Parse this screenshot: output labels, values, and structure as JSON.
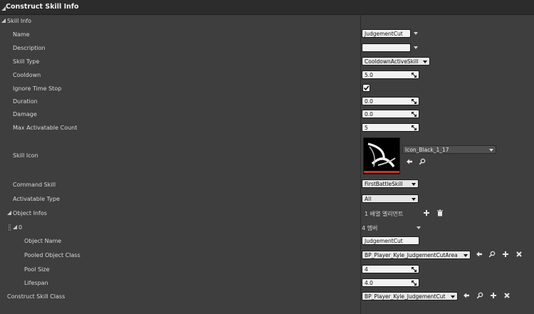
{
  "panel": {
    "title": "Construct Skill Info"
  },
  "sections": {
    "skill_info": "Skill Info",
    "object_infos": "Object Infos",
    "element_index": "0",
    "construct_skill_class": "Construct Skill Class"
  },
  "labels": {
    "name": "Name",
    "description": "Description",
    "skill_type": "Skill Type",
    "cooldown": "Cooldown",
    "ignore_time_stop": "Ignore Time Stop",
    "duration": "Duration",
    "damage": "Damage",
    "max_activatable_count": "Max Activatable Count",
    "skill_icon": "Skill Icon",
    "command_skill": "Command Skill",
    "activatable_type": "Activatable Type",
    "object_name": "Object Name",
    "pooled_object_class": "Pooled Object Class",
    "pool_size": "Pool Size",
    "lifespan": "Lifespan"
  },
  "values": {
    "name": "JudgementCut",
    "description": "",
    "skill_type": "CooldownActiveSkill",
    "cooldown": "5.0",
    "ignore_time_stop": true,
    "duration": "0.0",
    "damage": "0.0",
    "max_activatable_count": "5",
    "skill_icon_asset": "Icon_Black_1_17",
    "command_skill": "FirstBattleSkill",
    "activatable_type": "All",
    "object_infos_count": "1 배열 엘리먼트",
    "element_members": "4 멤버",
    "object_name": "JudgementCut",
    "pooled_object_class": "BP_Player_Kyle_JudgementCutArea",
    "pool_size": "4",
    "lifespan": "4.0",
    "construct_skill_class": "BP_Player_Kyle_JudgementCut"
  },
  "icons": {
    "use_selected": "arrow-left-icon",
    "browse": "search-icon",
    "add": "plus-icon",
    "remove": "trash-icon",
    "clear": "close-icon",
    "spin": "spin-arrows-icon"
  },
  "colors": {
    "background": "#3e3e3e",
    "header": "#2c2c2c",
    "field": "#f2f2f2",
    "icon_accent": "#c0392b"
  }
}
